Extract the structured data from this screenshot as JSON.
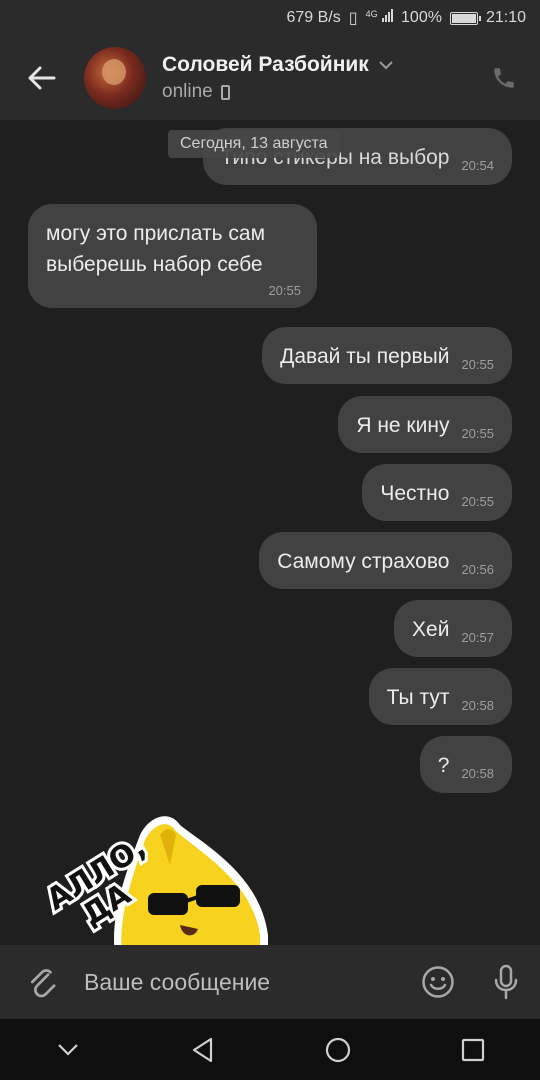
{
  "status_bar": {
    "speed": "679 B/s",
    "network": "4G",
    "battery": "100%",
    "time": "21:10",
    "battery_level": 1.0
  },
  "header": {
    "name": "Соловей Разбойник",
    "status": "online",
    "icons": [
      "back-arrow-icon",
      "chevron-down-icon",
      "mobile-device-icon",
      "phone-icon"
    ]
  },
  "chat": {
    "date_label": "Сегодня, 13 августа",
    "messages": [
      {
        "dir": "out",
        "text": "Типо стикеры на выбор",
        "time": "20:54"
      },
      {
        "dir": "in",
        "lines": [
          "могу это прислать сам",
          "выберешь набор себе"
        ],
        "time": "20:55"
      },
      {
        "dir": "out",
        "text": "Давай ты первый",
        "time": "20:55"
      },
      {
        "dir": "out",
        "text": "Я не кину",
        "time": "20:55"
      },
      {
        "dir": "out",
        "text": "Честно",
        "time": "20:55"
      },
      {
        "dir": "out",
        "text": "Самому страхово",
        "time": "20:56"
      },
      {
        "dir": "out",
        "text": "Хей",
        "time": "20:57"
      },
      {
        "dir": "out",
        "text": "Ты тут",
        "time": "20:58"
      },
      {
        "dir": "out",
        "text": "?",
        "time": "20:58"
      }
    ],
    "sticker": {
      "name": "banana-sticker",
      "text": "АЛЛО, ДА"
    }
  },
  "composer": {
    "placeholder": "Ваше сообщение",
    "icons": [
      "paperclip-icon",
      "emoji-icon",
      "microphone-icon"
    ]
  },
  "nav": {
    "icons": [
      "chevron-down-icon",
      "back-triangle-icon",
      "home-circle-icon",
      "recents-square-icon"
    ]
  },
  "colors": {
    "background": "#1f1f1f",
    "bar": "#2b2b2b",
    "bubble": "#424242",
    "sticker_yellow": "#f7d21e"
  }
}
